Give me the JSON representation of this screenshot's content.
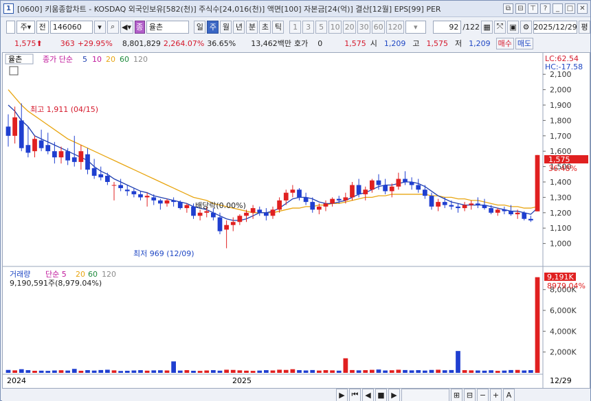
{
  "window": {
    "title": "[0600] 키움종합차트 - KOSDAQ 외국인보유[582(천)] 주식수[24,016(천)] 액면[100] 자본금[24(억)] 결산[12월] EPS[99] PER",
    "num": "1"
  },
  "toolbar": {
    "period_mode": "주",
    "price_type": "전",
    "code": "146060",
    "stock_name": "율촌",
    "periods": [
      "일",
      "주",
      "월",
      "년",
      "분",
      "초",
      "틱"
    ],
    "selected_period": "주",
    "intervals": [
      "1",
      "3",
      "5",
      "10",
      "20",
      "30",
      "60",
      "120"
    ],
    "count": "92",
    "total": "/122",
    "date": "2025/12/29",
    "ratio_btn": "평"
  },
  "quote": {
    "price": "1,575",
    "change": "363",
    "change_pct": "+29.95%",
    "volume": "8,801,829",
    "volume_pct": "2,264.07%",
    "turnover": "36.65%",
    "amount": "13,462백만",
    "hoga_label": "호가",
    "hoga_val": "0",
    "hoga_price": "1,575",
    "open_label": "시",
    "open": "1,209",
    "high_label": "고",
    "high": "1,575",
    "low_label": "저",
    "low": "1,209",
    "buy": "매수",
    "sell": "매도"
  },
  "price_panel": {
    "tag": "율촌",
    "legend_label": "종가 단순",
    "ma": [
      "5",
      "10",
      "20",
      "60",
      "120"
    ],
    "ma_colors": [
      "#1f3fb0",
      "#c0179b",
      "#e8a510",
      "#1d8a3c",
      "#8a8a8a"
    ],
    "lc": "LC:62.54",
    "hc": "HC:-17.58",
    "high_label": "최고 1,911 (04/15)",
    "low_label": "최저 969 (12/09)",
    "event": "배당락(0.00%)",
    "last_price": "1,575",
    "last_pct": "36.48%",
    "yticks": [
      "2,100",
      "2,000",
      "1,900",
      "1,800",
      "1,700",
      "1,600",
      "1,500",
      "1,400",
      "1,300",
      "1,200",
      "1,100",
      "1,000"
    ]
  },
  "volume_panel": {
    "legend_label": "거래량",
    "legend_ma": "단순 5",
    "ma": [
      "20",
      "60",
      "120"
    ],
    "total": "9,190,591주(8,979.04%)",
    "last_val": "9,191K",
    "last_pct": "8979.04%",
    "yticks": [
      "8,000K",
      "6,000K",
      "4,000K",
      "2,000K"
    ]
  },
  "xaxis": {
    "labels": [
      "2024",
      "2025"
    ],
    "last_date": "12/29"
  },
  "chart_data": {
    "type": "candlestick",
    "ylim": [
      900,
      2150
    ],
    "candles": [
      [
        1760,
        1840,
        1630,
        1700
      ],
      [
        1700,
        1890,
        1650,
        1820
      ],
      [
        1800,
        1911,
        1600,
        1620
      ],
      [
        1640,
        1760,
        1560,
        1590
      ],
      [
        1600,
        1700,
        1560,
        1680
      ],
      [
        1670,
        1740,
        1600,
        1620
      ],
      [
        1640,
        1720,
        1580,
        1600
      ],
      [
        1600,
        1660,
        1520,
        1560
      ],
      [
        1560,
        1630,
        1520,
        1600
      ],
      [
        1600,
        1620,
        1510,
        1540
      ],
      [
        1560,
        1700,
        1500,
        1530
      ],
      [
        1530,
        1640,
        1480,
        1600
      ],
      [
        1580,
        1620,
        1450,
        1480
      ],
      [
        1490,
        1550,
        1420,
        1440
      ],
      [
        1450,
        1500,
        1410,
        1430
      ],
      [
        1440,
        1460,
        1380,
        1400
      ],
      [
        1380,
        1400,
        1280,
        1380
      ],
      [
        1380,
        1420,
        1340,
        1360
      ],
      [
        1350,
        1380,
        1310,
        1340
      ],
      [
        1340,
        1360,
        1300,
        1320
      ],
      [
        1320,
        1340,
        1280,
        1300
      ],
      [
        1300,
        1330,
        1240,
        1310
      ],
      [
        1300,
        1320,
        1250,
        1280
      ],
      [
        1280,
        1290,
        1220,
        1260
      ],
      [
        1260,
        1290,
        1240,
        1280
      ],
      [
        1280,
        1300,
        1240,
        1270
      ],
      [
        1270,
        1280,
        1220,
        1230
      ],
      [
        1230,
        1260,
        1200,
        1250
      ],
      [
        1240,
        1260,
        1160,
        1180
      ],
      [
        1180,
        1220,
        1150,
        1200
      ],
      [
        1200,
        1240,
        1170,
        1210
      ],
      [
        1200,
        1230,
        1150,
        1170
      ],
      [
        1170,
        1200,
        1060,
        1080
      ],
      [
        1090,
        1150,
        969,
        1120
      ],
      [
        1120,
        1170,
        1080,
        1140
      ],
      [
        1140,
        1190,
        1120,
        1180
      ],
      [
        1180,
        1220,
        1140,
        1200
      ],
      [
        1200,
        1250,
        1160,
        1230
      ],
      [
        1220,
        1240,
        1180,
        1200
      ],
      [
        1200,
        1230,
        1150,
        1180
      ],
      [
        1180,
        1240,
        1160,
        1220
      ],
      [
        1220,
        1300,
        1200,
        1280
      ],
      [
        1280,
        1350,
        1250,
        1330
      ],
      [
        1330,
        1380,
        1300,
        1350
      ],
      [
        1350,
        1360,
        1280,
        1300
      ],
      [
        1300,
        1330,
        1250,
        1270
      ],
      [
        1270,
        1300,
        1200,
        1220
      ],
      [
        1220,
        1260,
        1190,
        1240
      ],
      [
        1240,
        1280,
        1210,
        1260
      ],
      [
        1260,
        1300,
        1240,
        1290
      ],
      [
        1290,
        1310,
        1260,
        1280
      ],
      [
        1280,
        1330,
        1260,
        1300
      ],
      [
        1300,
        1400,
        1280,
        1380
      ],
      [
        1380,
        1420,
        1300,
        1320
      ],
      [
        1320,
        1370,
        1280,
        1350
      ],
      [
        1350,
        1420,
        1330,
        1410
      ],
      [
        1410,
        1450,
        1350,
        1380
      ],
      [
        1380,
        1420,
        1320,
        1340
      ],
      [
        1340,
        1390,
        1300,
        1370
      ],
      [
        1370,
        1460,
        1350,
        1420
      ],
      [
        1420,
        1470,
        1380,
        1400
      ],
      [
        1400,
        1430,
        1350,
        1380
      ],
      [
        1380,
        1420,
        1330,
        1350
      ],
      [
        1350,
        1380,
        1290,
        1310
      ],
      [
        1310,
        1330,
        1220,
        1240
      ],
      [
        1240,
        1290,
        1210,
        1270
      ],
      [
        1270,
        1300,
        1230,
        1250
      ],
      [
        1250,
        1280,
        1220,
        1240
      ],
      [
        1240,
        1260,
        1200,
        1230
      ],
      [
        1230,
        1270,
        1210,
        1250
      ],
      [
        1250,
        1280,
        1220,
        1260
      ],
      [
        1260,
        1300,
        1230,
        1250
      ],
      [
        1250,
        1290,
        1220,
        1230
      ],
      [
        1230,
        1250,
        1190,
        1200
      ],
      [
        1200,
        1230,
        1180,
        1220
      ],
      [
        1220,
        1240,
        1190,
        1210
      ],
      [
        1210,
        1250,
        1180,
        1190
      ],
      [
        1190,
        1220,
        1160,
        1200
      ],
      [
        1200,
        1210,
        1150,
        1160
      ],
      [
        1160,
        1180,
        1140,
        1150
      ],
      [
        1209,
        1575,
        1209,
        1575
      ]
    ],
    "volume": [
      280,
      240,
      350,
      260,
      200,
      210,
      190,
      230,
      250,
      220,
      380,
      200,
      260,
      220,
      270,
      300,
      240,
      180,
      200,
      230,
      260,
      210,
      240,
      250,
      230,
      1100,
      220,
      260,
      200,
      190,
      230,
      260,
      210,
      300,
      280,
      240,
      210,
      190,
      220,
      260,
      230,
      300,
      280,
      350,
      260,
      230,
      270,
      220,
      260,
      240,
      210,
      1400,
      270,
      240,
      260,
      290,
      320,
      230,
      250,
      300,
      270,
      240,
      260,
      220,
      280,
      300,
      250,
      270,
      2100,
      260,
      240,
      230,
      210,
      250,
      190,
      220,
      270,
      280,
      230,
      260,
      9191
    ],
    "ma5": [
      1900,
      1860,
      1800,
      1760,
      1700,
      1680,
      1660,
      1640,
      1620,
      1600,
      1580,
      1560,
      1540,
      1500,
      1470,
      1450,
      1420,
      1400,
      1380,
      1360,
      1340,
      1330,
      1310,
      1300,
      1290,
      1280,
      1270,
      1260,
      1240,
      1230,
      1220,
      1200,
      1180,
      1160,
      1150,
      1150,
      1160,
      1180,
      1200,
      1200,
      1210,
      1230,
      1260,
      1290,
      1300,
      1300,
      1290,
      1270,
      1260,
      1260,
      1270,
      1280,
      1300,
      1320,
      1330,
      1350,
      1370,
      1380,
      1380,
      1390,
      1400,
      1400,
      1390,
      1370,
      1340,
      1310,
      1290,
      1270,
      1260,
      1250,
      1250,
      1250,
      1250,
      1240,
      1230,
      1220,
      1210,
      1210,
      1200,
      1190,
      1230
    ],
    "ma20": [
      2000,
      1950,
      1900,
      1860,
      1830,
      1800,
      1770,
      1740,
      1710,
      1680,
      1660,
      1640,
      1620,
      1600,
      1580,
      1560,
      1540,
      1520,
      1500,
      1480,
      1460,
      1440,
      1420,
      1400,
      1380,
      1360,
      1340,
      1320,
      1300,
      1290,
      1280,
      1260,
      1250,
      1240,
      1230,
      1220,
      1210,
      1200,
      1200,
      1200,
      1200,
      1210,
      1220,
      1230,
      1230,
      1240,
      1240,
      1250,
      1250,
      1260,
      1260,
      1270,
      1280,
      1290,
      1300,
      1300,
      1310,
      1310,
      1320,
      1320,
      1320,
      1320,
      1320,
      1320,
      1310,
      1310,
      1300,
      1300,
      1290,
      1290,
      1280,
      1280,
      1270,
      1260,
      1250,
      1250,
      1240,
      1240,
      1230,
      1230,
      1240
    ]
  }
}
